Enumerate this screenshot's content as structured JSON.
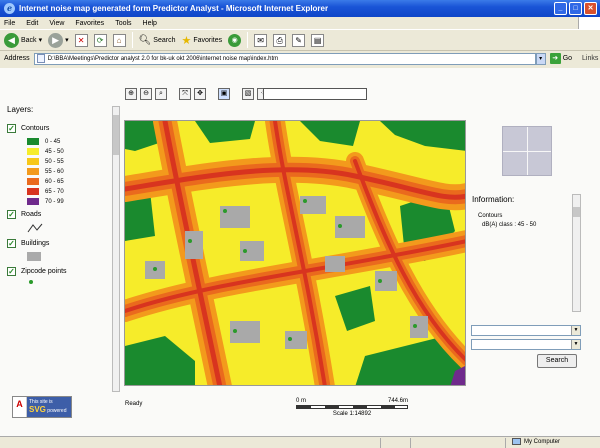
{
  "window": {
    "title": "Internet noise map generated form Predictor Analyst - Microsoft Internet Explorer",
    "menu": [
      "File",
      "Edit",
      "View",
      "Favorites",
      "Tools",
      "Help"
    ]
  },
  "toolbar": {
    "back_label": "Back",
    "search_label": "Search",
    "favorites_label": "Favorites"
  },
  "addressbar": {
    "label": "Address",
    "url": "D:\\BBA\\Meetings\\Predictor analyst 2.0 for bk-uk okt 2006\\internet noise map\\index.htm",
    "go_label": "Go",
    "links_label": "Links"
  },
  "layers": {
    "heading": "Layers:",
    "contours": {
      "label": "Contours",
      "classes": [
        {
          "label": "0 - 45",
          "color": "#1a8a2e"
        },
        {
          "label": "45 - 50",
          "color": "#f6ec2a"
        },
        {
          "label": "50 - 55",
          "color": "#f7c718"
        },
        {
          "label": "55 - 60",
          "color": "#f39a1c"
        },
        {
          "label": "60 - 65",
          "color": "#ea6a1d"
        },
        {
          "label": "65 - 70",
          "color": "#d8341f"
        },
        {
          "label": "70 - 99",
          "color": "#6f2a8c"
        }
      ]
    },
    "roads_label": "Roads",
    "buildings_label": "Buildings",
    "zipcode_label": "Zipcode points"
  },
  "adobe": {
    "left": "A",
    "line1": "This site is",
    "line2": "SVG",
    "line3": "powered"
  },
  "map": {
    "status": "Ready",
    "scale_start": "0 m",
    "scale_end": "744.6m",
    "scale_ratio": "Scale 1:14892"
  },
  "info": {
    "title": "Information:",
    "layer": "Contours",
    "class_line": "dB(A) class :   45 - 50"
  },
  "search": {
    "button_label": "Search"
  },
  "statusbar": {
    "zone": "My Computer"
  }
}
